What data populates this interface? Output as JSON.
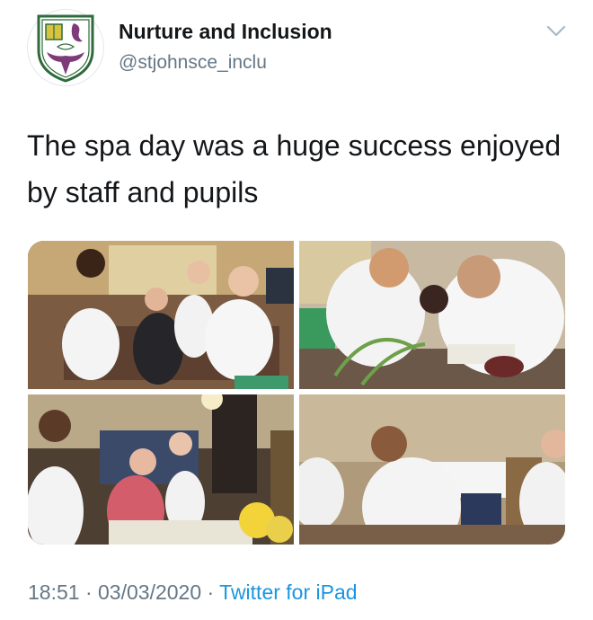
{
  "account": {
    "display_name": "Nurture and Inclusion",
    "handle": "@stjohnsce_inclu",
    "avatar_icon": "school-crest-icon"
  },
  "tweet": {
    "text": "The spa day was a huge success enjoyed by staff and pupils",
    "time": "18:51",
    "separator": " · ",
    "date": "03/03/2020",
    "source": "Twitter for iPad"
  },
  "media": {
    "photo_count": 4
  },
  "colors": {
    "text": "#14171a",
    "secondary": "#657786",
    "link": "#1b95e0"
  },
  "icons": {
    "menu": "chevron-down-icon"
  }
}
